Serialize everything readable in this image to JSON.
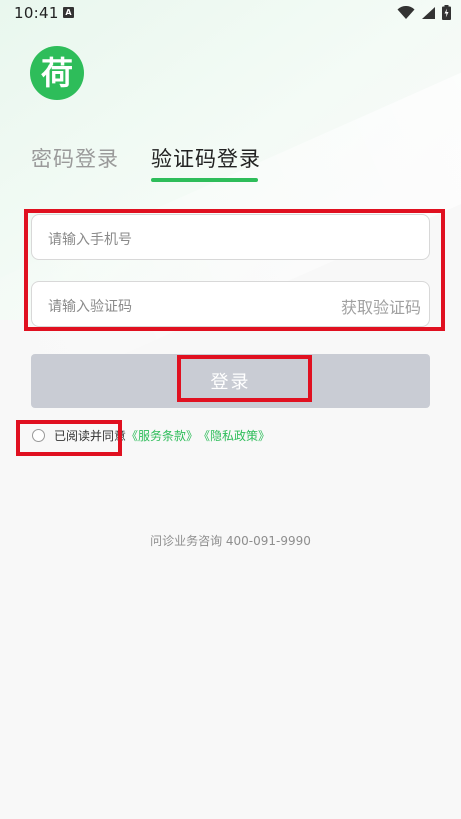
{
  "status_bar": {
    "time": "10:41",
    "notification_glyph": "A",
    "icons": [
      "wifi-icon",
      "signal-icon",
      "battery-icon"
    ]
  },
  "logo": {
    "glyph": "荷",
    "color": "#2ebd5a"
  },
  "tabs": [
    {
      "label": "密码登录",
      "active": false
    },
    {
      "label": "验证码登录",
      "active": true
    }
  ],
  "form": {
    "phone_placeholder": "请输入手机号",
    "code_placeholder": "请输入验证码",
    "get_code_label": "获取验证码"
  },
  "login_button": {
    "label": "登录",
    "enabled": false
  },
  "agreement": {
    "checked": false,
    "prefix": "已阅读并同意",
    "service_terms": "《服务条款》",
    "privacy_policy": "《隐私政策》"
  },
  "consult": {
    "text": "问诊业务咨询 400-091-9990"
  },
  "colors": {
    "accent": "#2ebd5a",
    "annotation": "#e01020",
    "button_disabled": "#c9ccd4"
  }
}
